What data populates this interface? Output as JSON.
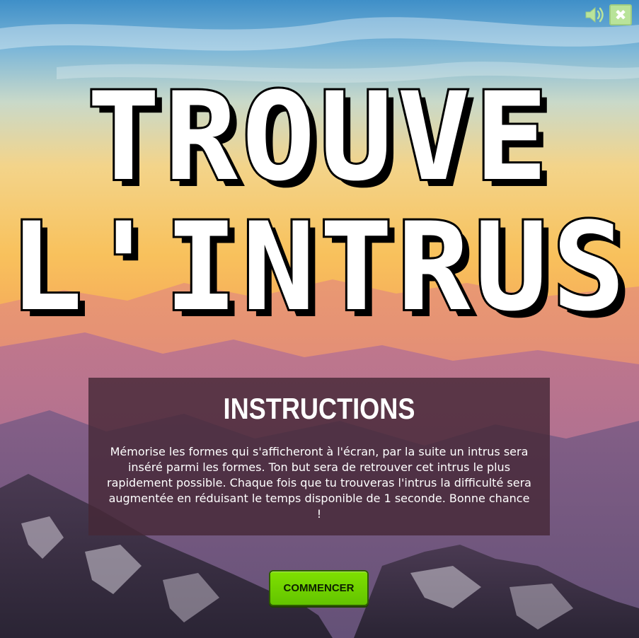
{
  "game": {
    "title_line1": "TROUVE",
    "title_line2": "L'INTRUS"
  },
  "controls": {
    "sound_icon": "speaker-icon",
    "close_icon": "close-icon",
    "close_symbol": "✖"
  },
  "instructions": {
    "heading": "INSTRUCTIONS",
    "body": "Mémorise les formes qui s'afficheront à l'écran, par la suite un intrus sera inséré parmi les formes. Ton but sera de retrouver cet intrus le plus rapidement possible. Chaque fois que tu trouveras l'intrus la difficulté sera augmentée en réduisant le temps disponible de 1 seconde. Bonne chance !"
  },
  "start_button": {
    "label": "COMMENCER"
  },
  "colors": {
    "button_green": "#6fd400",
    "panel_bg": "rgba(70,40,55,0.82)",
    "controls_green": "#b9e39a"
  }
}
